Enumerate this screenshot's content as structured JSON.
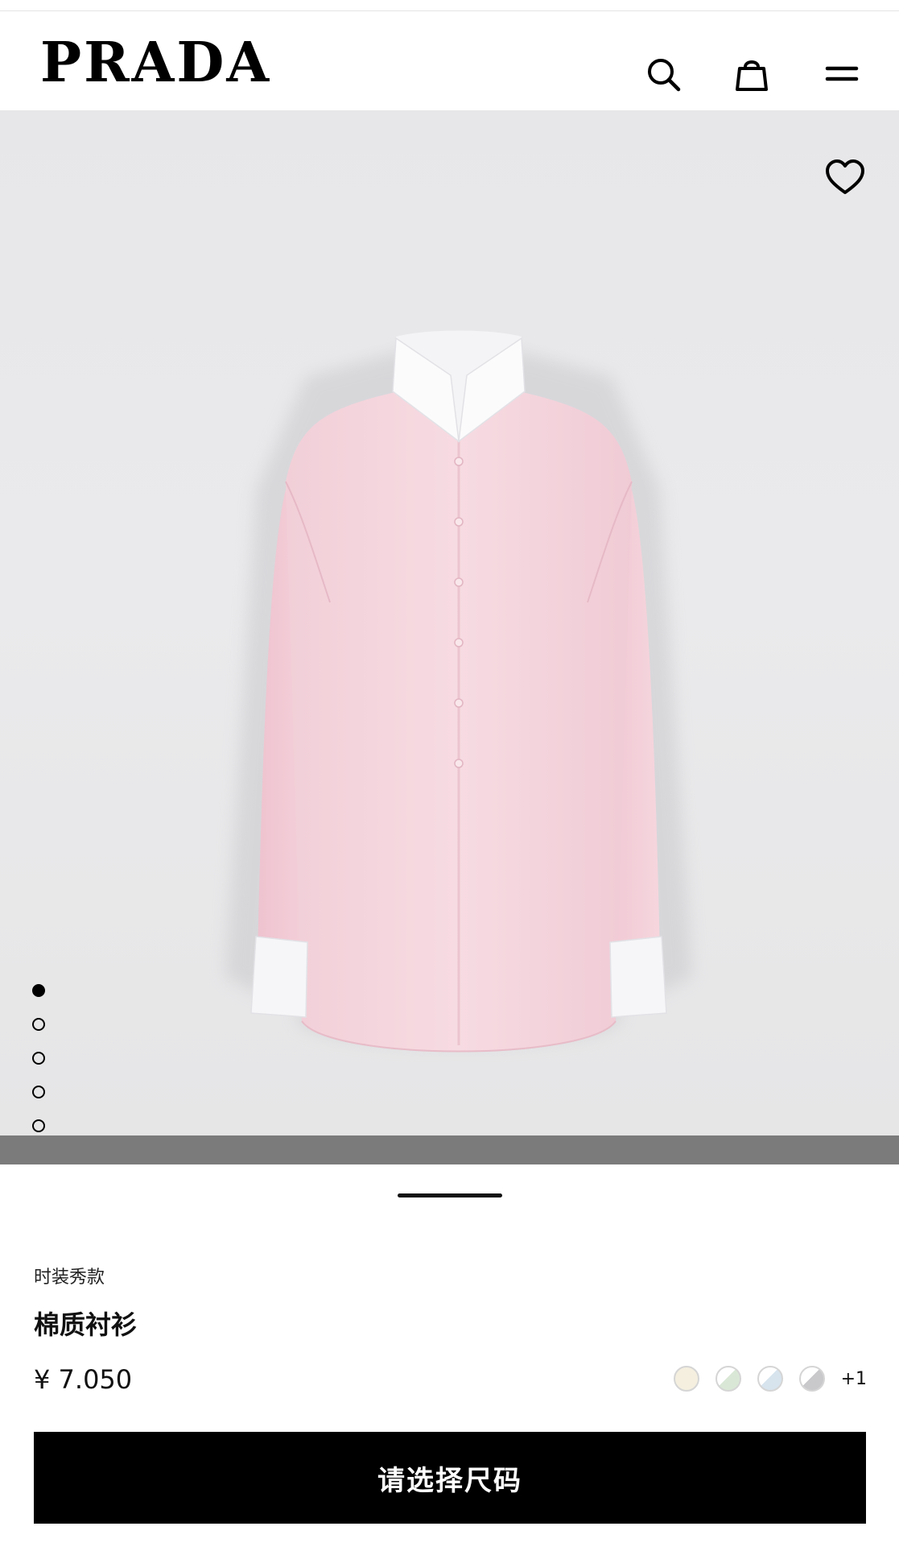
{
  "header": {
    "brand": "PRADA",
    "icons": [
      "search-icon",
      "bag-icon",
      "menu-icon"
    ]
  },
  "gallery": {
    "favorite_icon": "heart-icon",
    "dots_total": 5,
    "active_dot_index": 0,
    "product_image": "pink-cotton-shirt"
  },
  "product": {
    "tag": "时装秀款",
    "name": "棉质衬衫",
    "price": "¥ 7.050",
    "swatch_colors": [
      "#f4efdf",
      "#d9e8d6",
      "#d7e4ee",
      "#c9c9cc"
    ],
    "more_colors": "+1"
  },
  "cta": {
    "label": "请选择尺码"
  },
  "colors": {
    "accent": "#000000",
    "gallery_bg": "#e8e8ea",
    "shirt": "#f5d6de"
  }
}
